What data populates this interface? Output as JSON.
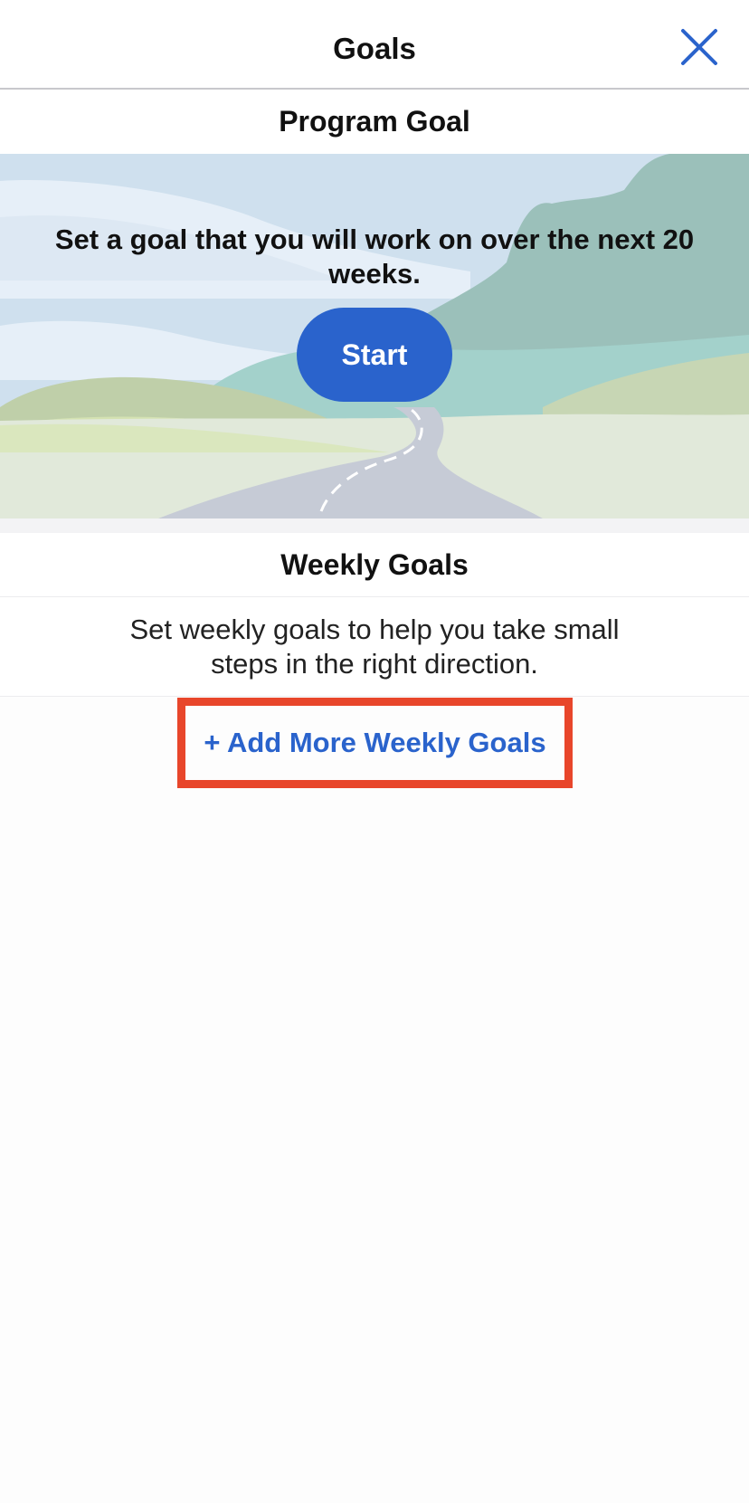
{
  "nav": {
    "title": "Goals",
    "close_icon": "close-icon"
  },
  "program_goal": {
    "header": "Program Goal",
    "prompt": "Set a goal that you will work on over the next 20 weeks.",
    "start_label": "Start"
  },
  "weekly_goals": {
    "header": "Weekly Goals",
    "description": "Set weekly goals to help you take small steps in the right direction.",
    "add_label": "+ Add More Weekly Goals"
  },
  "colors": {
    "accent": "#2a63cc",
    "highlight": "#e8462b"
  }
}
